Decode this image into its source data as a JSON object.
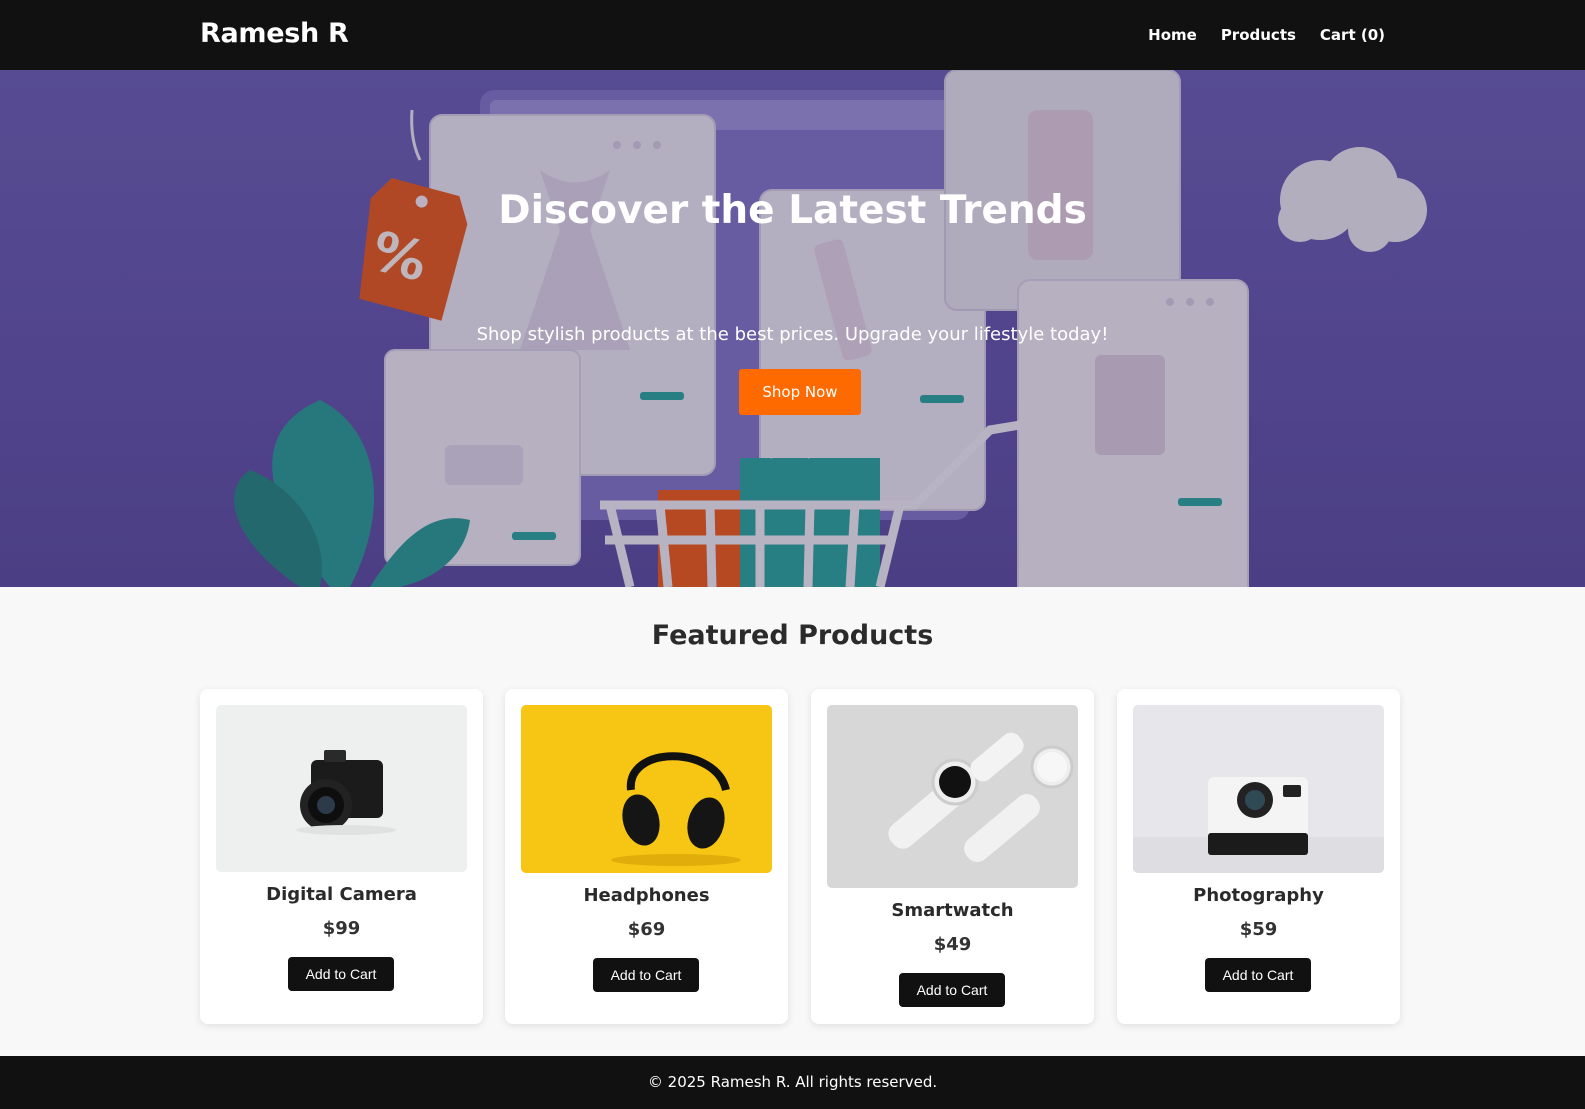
{
  "header": {
    "logo": "Ramesh R",
    "nav": {
      "home": "Home",
      "products": "Products",
      "cart": "Cart (0)"
    }
  },
  "hero": {
    "title": "Discover the Latest Trends",
    "subtitle": "Shop stylish products at the best prices. Upgrade your lifestyle today!",
    "cta": "Shop Now",
    "tag_symbol": "%"
  },
  "products": {
    "title": "Featured Products",
    "items": [
      {
        "name": "Digital Camera",
        "price": "$99",
        "button": "Add to Cart",
        "image": "camera-image"
      },
      {
        "name": "Headphones",
        "price": "$69",
        "button": "Add to Cart",
        "image": "headphones-image"
      },
      {
        "name": "Smartwatch",
        "price": "$49",
        "button": "Add to Cart",
        "image": "smartwatch-image"
      },
      {
        "name": "Photography",
        "price": "$59",
        "button": "Add to Cart",
        "image": "instant-camera-image"
      }
    ]
  },
  "footer": {
    "text": "© 2025 Ramesh R. All rights reserved."
  },
  "colors": {
    "header_bg": "#111111",
    "hero_bg": "#6154a8",
    "cta": "#ff6a00",
    "button": "#111111"
  }
}
